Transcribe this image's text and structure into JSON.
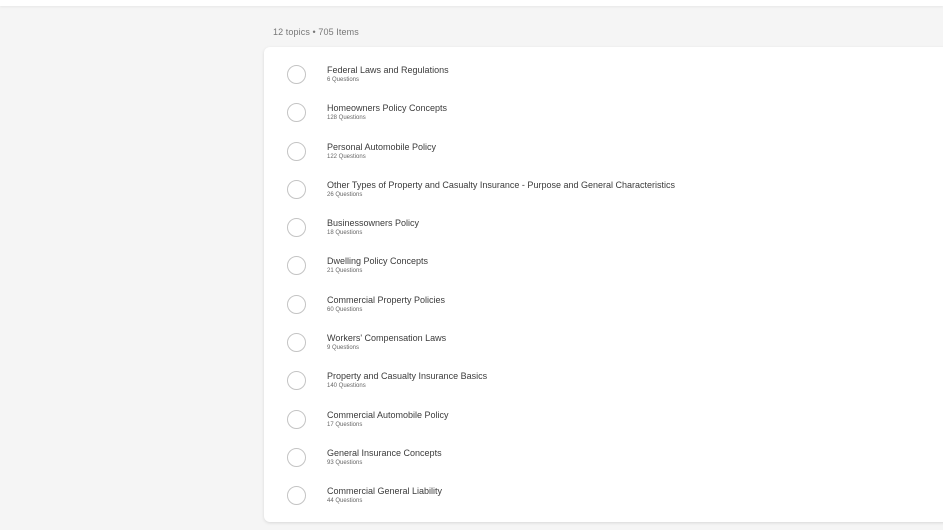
{
  "summary": "12 topics • 705 Items",
  "topics": [
    {
      "title": "Federal Laws and Regulations",
      "count": "6 Questions"
    },
    {
      "title": "Homeowners Policy Concepts",
      "count": "128 Questions"
    },
    {
      "title": "Personal Automobile Policy",
      "count": "122 Questions"
    },
    {
      "title": "Other Types of Property and Casualty Insurance - Purpose and General Characteristics",
      "count": "26 Questions"
    },
    {
      "title": "Businessowners Policy",
      "count": "18 Questions"
    },
    {
      "title": "Dwelling Policy Concepts",
      "count": "21 Questions"
    },
    {
      "title": "Commercial Property Policies",
      "count": "60 Questions"
    },
    {
      "title": "Workers' Compensation Laws",
      "count": "9 Questions"
    },
    {
      "title": "Property and Casualty Insurance Basics",
      "count": "140 Questions"
    },
    {
      "title": "Commercial Automobile Policy",
      "count": "17 Questions"
    },
    {
      "title": "General Insurance Concepts",
      "count": "93 Questions"
    },
    {
      "title": "Commercial General Liability",
      "count": "44 Questions"
    }
  ]
}
